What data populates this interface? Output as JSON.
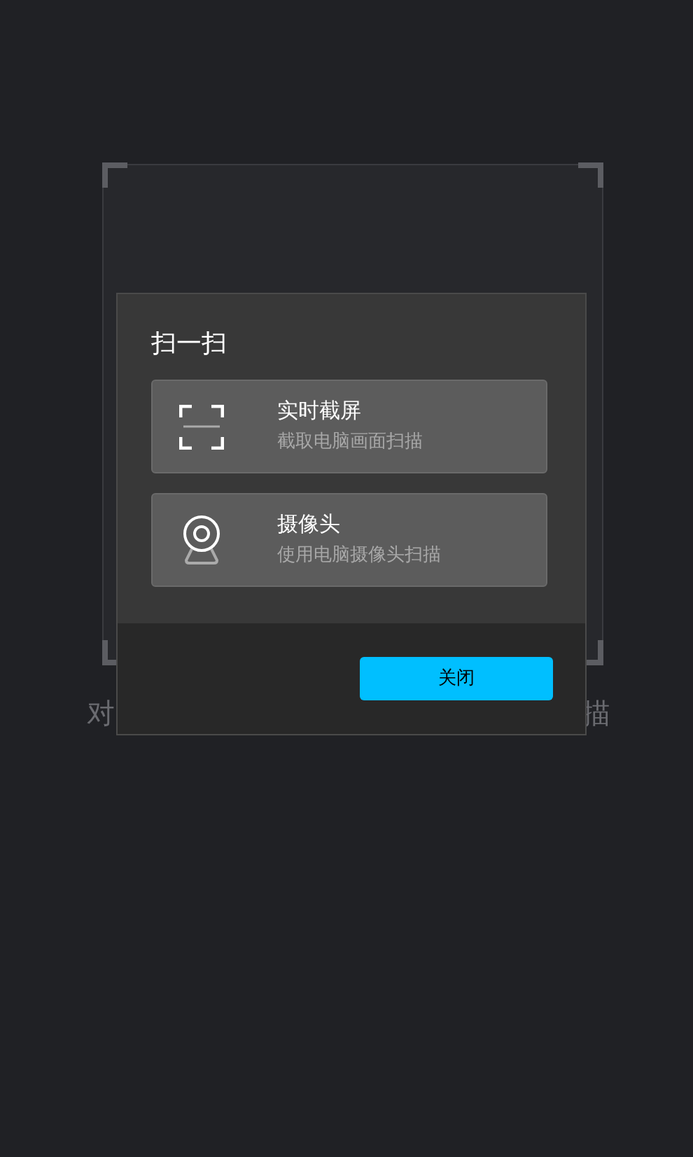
{
  "background": {
    "caption_left": "对",
    "caption_right": "描"
  },
  "dialog": {
    "title": "扫一扫",
    "options": [
      {
        "kind": "screenshot",
        "label": "实时截屏",
        "description": "截取电脑画面扫描"
      },
      {
        "kind": "camera",
        "label": "摄像头",
        "description": "使用电脑摄像头扫描"
      }
    ],
    "buttons": [
      "关闭"
    ]
  }
}
